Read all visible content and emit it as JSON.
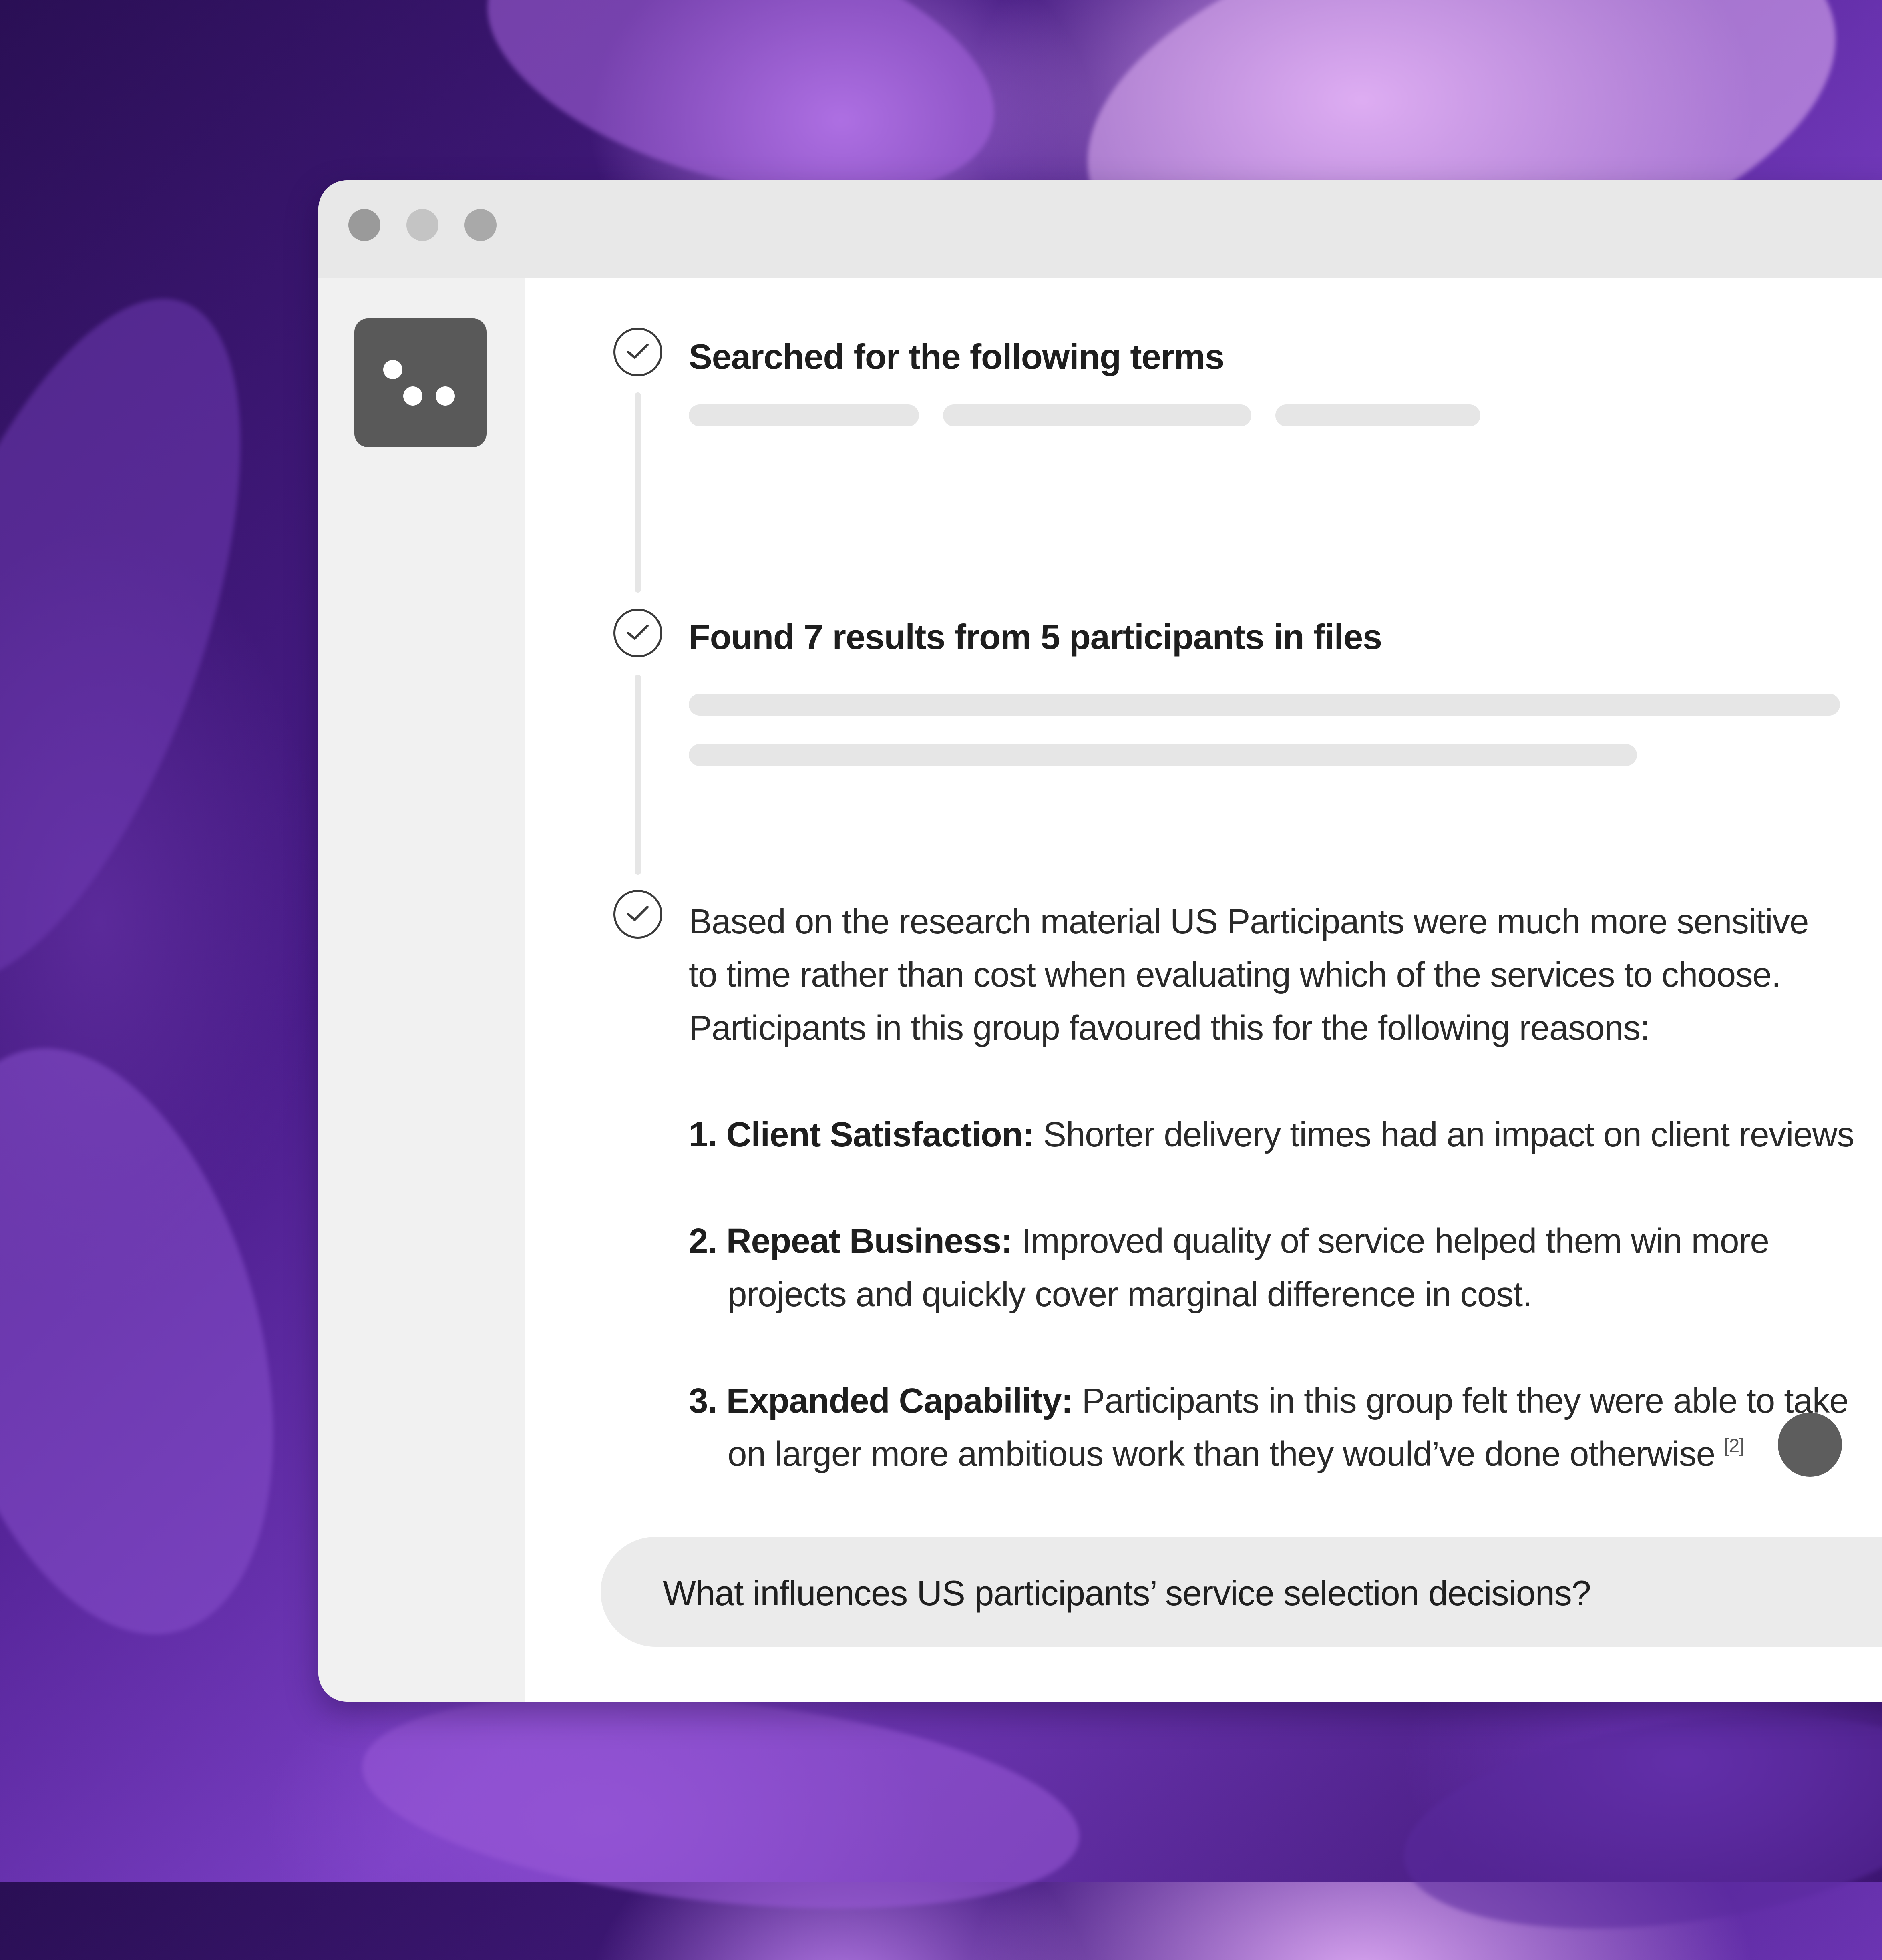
{
  "window": {
    "controls": [
      "close",
      "minimize",
      "zoom"
    ]
  },
  "sidebar": {
    "logo_icon": "three-dots-logo-icon"
  },
  "steps": [
    {
      "status": "complete",
      "title": "Searched for the following terms"
    },
    {
      "status": "complete",
      "title": "Found 7 results from 5 participants in files"
    }
  ],
  "answer": {
    "status": "complete",
    "intro_lines": [
      "Based on the research material US Participants were much more sensitive",
      "to time rather than cost when evaluating which of the services to choose.",
      "Participants in this group favoured this for the following reasons:"
    ],
    "reasons": [
      {
        "number": "1.",
        "heading": "Client Satisfaction:",
        "text": "Shorter delivery times had an impact on client reviews"
      },
      {
        "number": "2.",
        "heading": "Repeat Business:",
        "text": "Improved quality of service helped them win more",
        "continuation": "projects and quickly cover marginal difference in cost."
      },
      {
        "number": "3.",
        "heading": "Expanded Capability:",
        "text": "Participants in this group felt they were able to take",
        "continuation": "on larger more ambitious work than they would’ve done otherwise",
        "citation": "[2]"
      }
    ]
  },
  "chat_input": {
    "value": "What influences US participants’ service selection decisions?"
  },
  "colors": {
    "window_bg": "#f1f1f1",
    "titlebar": "#e8e8e8",
    "content_bg": "#ffffff",
    "logo_bg": "#595959",
    "skeleton": "#e6e6e6",
    "background_accent": "#7a3fc4"
  }
}
